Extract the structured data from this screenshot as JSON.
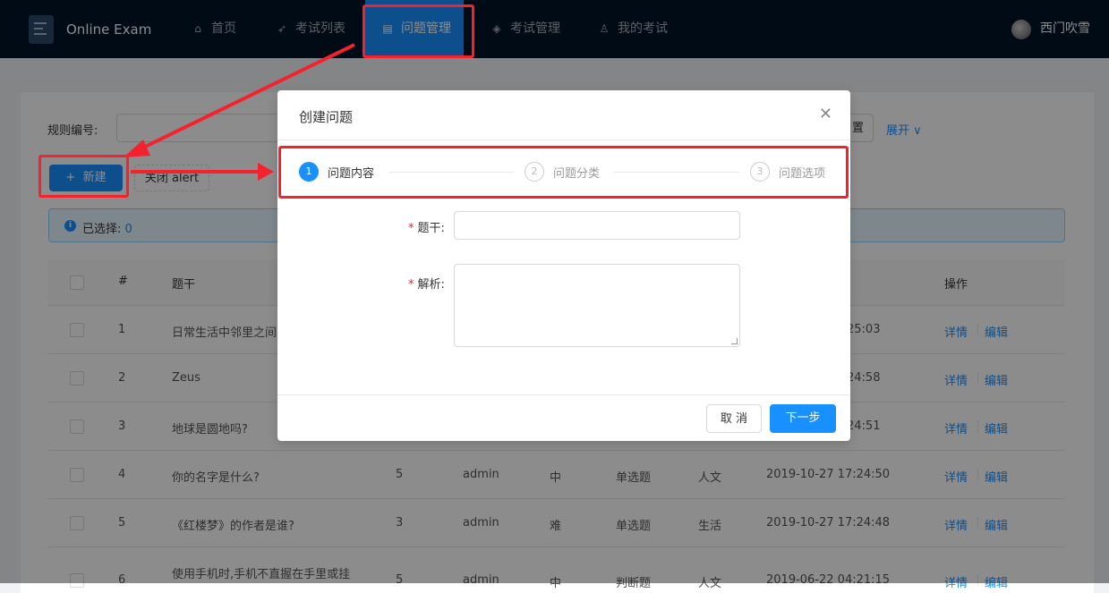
{
  "nav": {
    "app_title": "Online Exam",
    "items": [
      {
        "label": "首页",
        "icon": "home-icon"
      },
      {
        "label": "考试列表",
        "icon": "rocket-icon"
      },
      {
        "label": "问题管理",
        "icon": "form-icon",
        "active": true
      },
      {
        "label": "考试管理",
        "icon": "database-icon"
      },
      {
        "label": "我的考试",
        "icon": "user-icon"
      }
    ],
    "username": "西门吹雪"
  },
  "search": {
    "rule_label": "规则编号:",
    "reset_label": "置",
    "expand_label": "展开"
  },
  "toolbar": {
    "new_label": "新建",
    "close_alert_label": "关闭 alert"
  },
  "alert": {
    "selected_label": "已选择:",
    "selected_count": "0"
  },
  "table": {
    "headers": {
      "index": "#",
      "stem": "题干",
      "action": "操作"
    },
    "rows": [
      {
        "index": "1",
        "stem": "日常生活中邻里之间",
        "time": "25:03",
        "detail": "详情",
        "edit": "编辑"
      },
      {
        "index": "2",
        "stem": "Zeus",
        "time": "24:58",
        "detail": "详情",
        "edit": "编辑"
      },
      {
        "index": "3",
        "stem": "地球是圆地吗?",
        "time": "24:51",
        "detail": "详情",
        "edit": "编辑"
      },
      {
        "index": "4",
        "stem": "你的名字是什么?",
        "score": "5",
        "creator": "admin",
        "level": "中",
        "type": "单选题",
        "category": "人文",
        "time": "2019-10-27 17:24:50",
        "detail": "详情",
        "edit": "编辑"
      },
      {
        "index": "5",
        "stem": "《红楼梦》的作者是谁?",
        "score": "3",
        "creator": "admin",
        "level": "难",
        "type": "单选题",
        "category": "生活",
        "time": "2019-10-27 17:24:48",
        "detail": "详情",
        "edit": "编辑"
      },
      {
        "index": "6",
        "stem": "使用手机时,手机不直握在手里或挂",
        "score": "5",
        "creator": "admin",
        "level": "中",
        "type": "判断题",
        "category": "人文",
        "time": "2019-06-22 04:21:15",
        "detail": "详情",
        "edit": "编辑"
      }
    ]
  },
  "modal": {
    "title": "创建问题",
    "steps": [
      {
        "num": "1",
        "label": "问题内容"
      },
      {
        "num": "2",
        "label": "问题分类"
      },
      {
        "num": "3",
        "label": "问题选项"
      }
    ],
    "form": {
      "stem_label": "题干",
      "analysis_label": "解析",
      "colon": ":"
    },
    "cancel_label": "取 消",
    "next_label": "下一步"
  },
  "colors": {
    "nav_bg": "#001529",
    "primary": "#1890ff",
    "annotation": "#f5222d"
  }
}
